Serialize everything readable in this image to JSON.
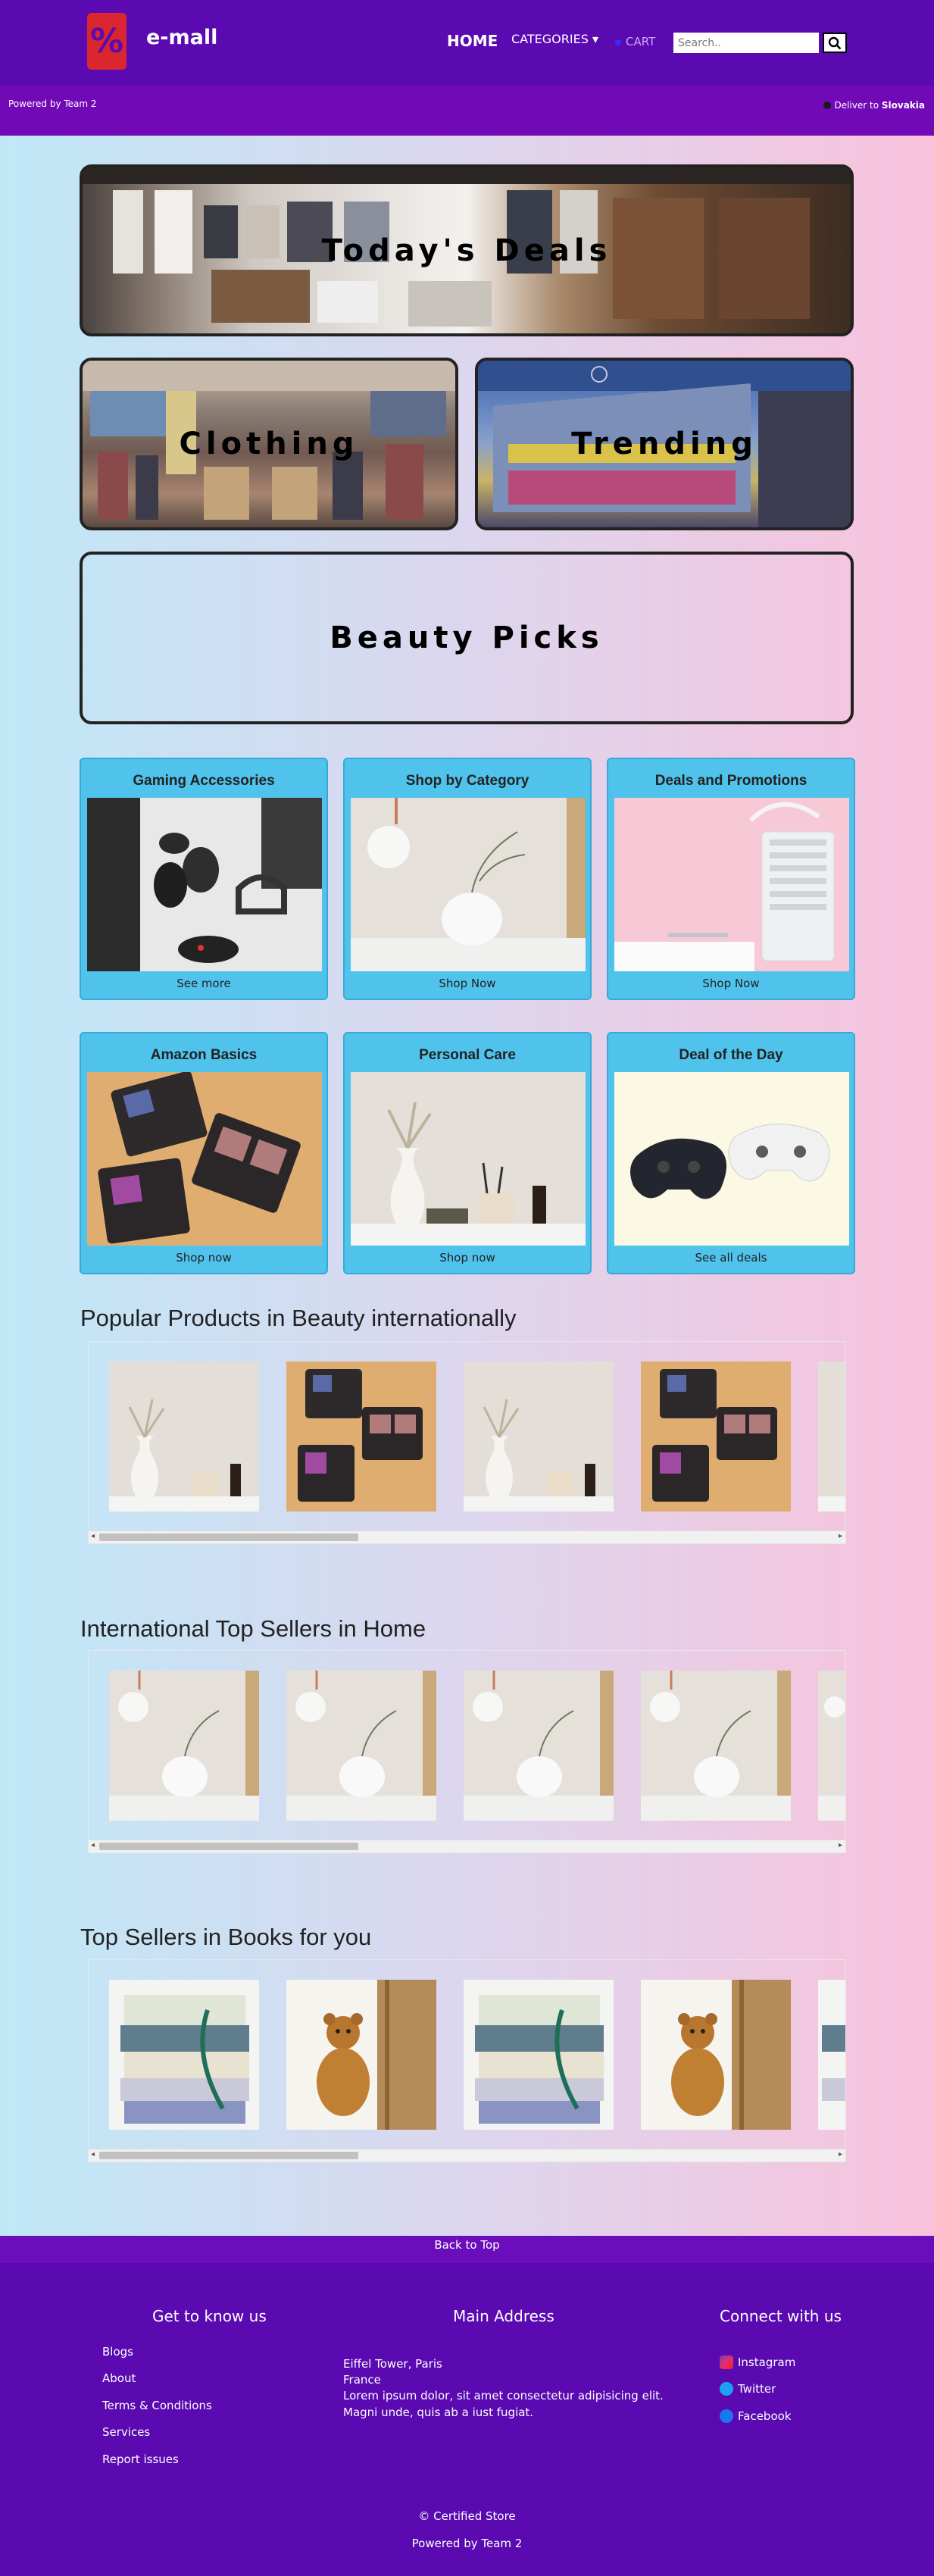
{
  "header": {
    "brand": "e-mall",
    "logo_symbol": "%",
    "nav_home": "HOME",
    "nav_categories": "CATEGORIES ▾",
    "cart": "CART",
    "search_placeholder": "Search..",
    "search_icon": "search-icon"
  },
  "subbar": {
    "powered_by": "Powered by Team 2",
    "deliver_label": "Deliver to",
    "deliver_country": "Slovakia"
  },
  "banners": {
    "deals": "Today's Deals",
    "clothing": "Clothing",
    "trending": "Trending",
    "beauty": "Beauty Picks"
  },
  "cards": [
    {
      "title": "Gaming Accessories",
      "link": "See more"
    },
    {
      "title": "Shop by Category",
      "link": "Shop Now"
    },
    {
      "title": "Deals and Promotions",
      "link": "Shop Now"
    },
    {
      "title": "Amazon Basics",
      "link": "Shop now"
    },
    {
      "title": "Personal Care",
      "link": "Shop now"
    },
    {
      "title": "Deal of the Day",
      "link": "See all deals"
    }
  ],
  "sections": {
    "beauty": "Popular Products in Beauty internationally",
    "home": "International Top Sellers in Home",
    "books": "Top Sellers in Books for you"
  },
  "footer": {
    "back_to_top": "Back to Top",
    "col1_title": "Get to know us",
    "col1_links": [
      "Blogs",
      "About",
      "Terms & Conditions",
      "Services",
      "Report issues"
    ],
    "col2_title": "Main Address",
    "address_lines": [
      "Eiffel Tower, Paris",
      "France",
      "Lorem ipsum dolor, sit amet consectetur adipisicing elit.",
      "Magni unde, quis ab a iust fugiat."
    ],
    "col3_title": "Connect with us",
    "social": [
      "Instagram",
      "Twitter",
      "Facebook"
    ],
    "copyright": "© Certified Store",
    "powered_by": "Powered by Team 2"
  },
  "colors": {
    "header_bg": "#5a0ab0",
    "subbar_bg": "#7209b7",
    "card_bg": "#4fc3ec",
    "logo_red": "#d9262f"
  }
}
